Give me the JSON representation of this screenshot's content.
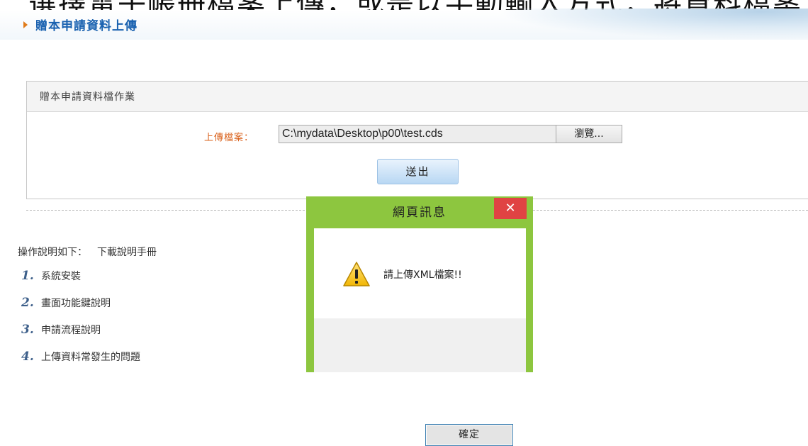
{
  "banner": {
    "text": "選擇電子帳冊檔案上傳，或是以手動輸入方式，將資料檔案上傳至系統，請注意檔案格式為 XML"
  },
  "header": {
    "title": "贈本申請資料上傳"
  },
  "panel": {
    "title": "贈本申請資料檔作業",
    "upload_label": "上傳檔案：",
    "file_path": "C:\\mydata\\Desktop\\p00\\test.cds",
    "browse_label": "瀏覽...",
    "submit_label": "送出"
  },
  "instructions": {
    "heading": "操作說明如下：",
    "download_link": "下載說明手冊",
    "items": [
      {
        "num": "1.",
        "label": "系統安裝"
      },
      {
        "num": "2.",
        "label": "畫面功能鍵說明"
      },
      {
        "num": "3.",
        "label": "申請流程說明"
      },
      {
        "num": "4.",
        "label": "上傳資料常發生的問題"
      }
    ]
  },
  "dialog": {
    "title": "網頁訊息",
    "close_glyph": "✕",
    "message": "請上傳XML檔案!!",
    "ok_label": "確定",
    "icon": "warning-icon",
    "frame_color": "#8dc63f",
    "close_color": "#e04343"
  },
  "colors": {
    "accent_orange": "#e07b1a",
    "title_blue": "#1a62b0"
  }
}
